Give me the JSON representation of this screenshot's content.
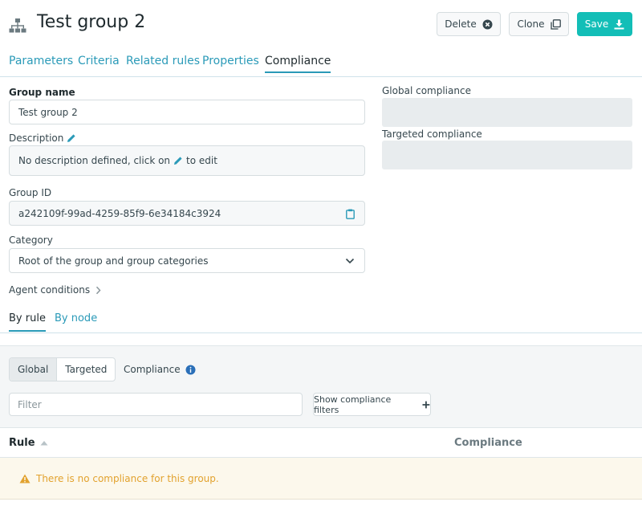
{
  "header": {
    "title": "Test group 2",
    "icon": "sitemap-icon",
    "delete_label": "Delete",
    "clone_label": "Clone",
    "save_label": "Save"
  },
  "tabs": [
    {
      "label": "Parameters"
    },
    {
      "label": "Criteria"
    },
    {
      "label": "Related rules"
    },
    {
      "label": "Properties"
    },
    {
      "label": "Compliance",
      "active": true
    }
  ],
  "form": {
    "group_name_label": "Group name",
    "group_name_value": "Test group 2",
    "description_label": "Description",
    "description_prefix": "No description defined, click on",
    "description_suffix": "to edit",
    "group_id_label": "Group ID",
    "group_id_value": "a242109f-99ad-4259-85f9-6e34184c3924",
    "category_label": "Category",
    "category_value": "Root of the group and group categories",
    "agent_conditions_label": "Agent conditions"
  },
  "summary": {
    "global_label": "Global compliance",
    "targeted_label": "Targeted compliance"
  },
  "subtabs": [
    {
      "label": "By rule",
      "active": true
    },
    {
      "label": "By node"
    }
  ],
  "filters": {
    "global_label": "Global",
    "targeted_label": "Targeted",
    "compliance_label": "Compliance",
    "filter_placeholder": "Filter",
    "show_filters_label": "Show compliance filters"
  },
  "table": {
    "col_rule": "Rule",
    "col_compliance": "Compliance",
    "empty_message": "There is no compliance for this group."
  },
  "colors": {
    "accent": "#13beb7",
    "link": "#2a9ab8",
    "warning": "#e2a22e"
  }
}
